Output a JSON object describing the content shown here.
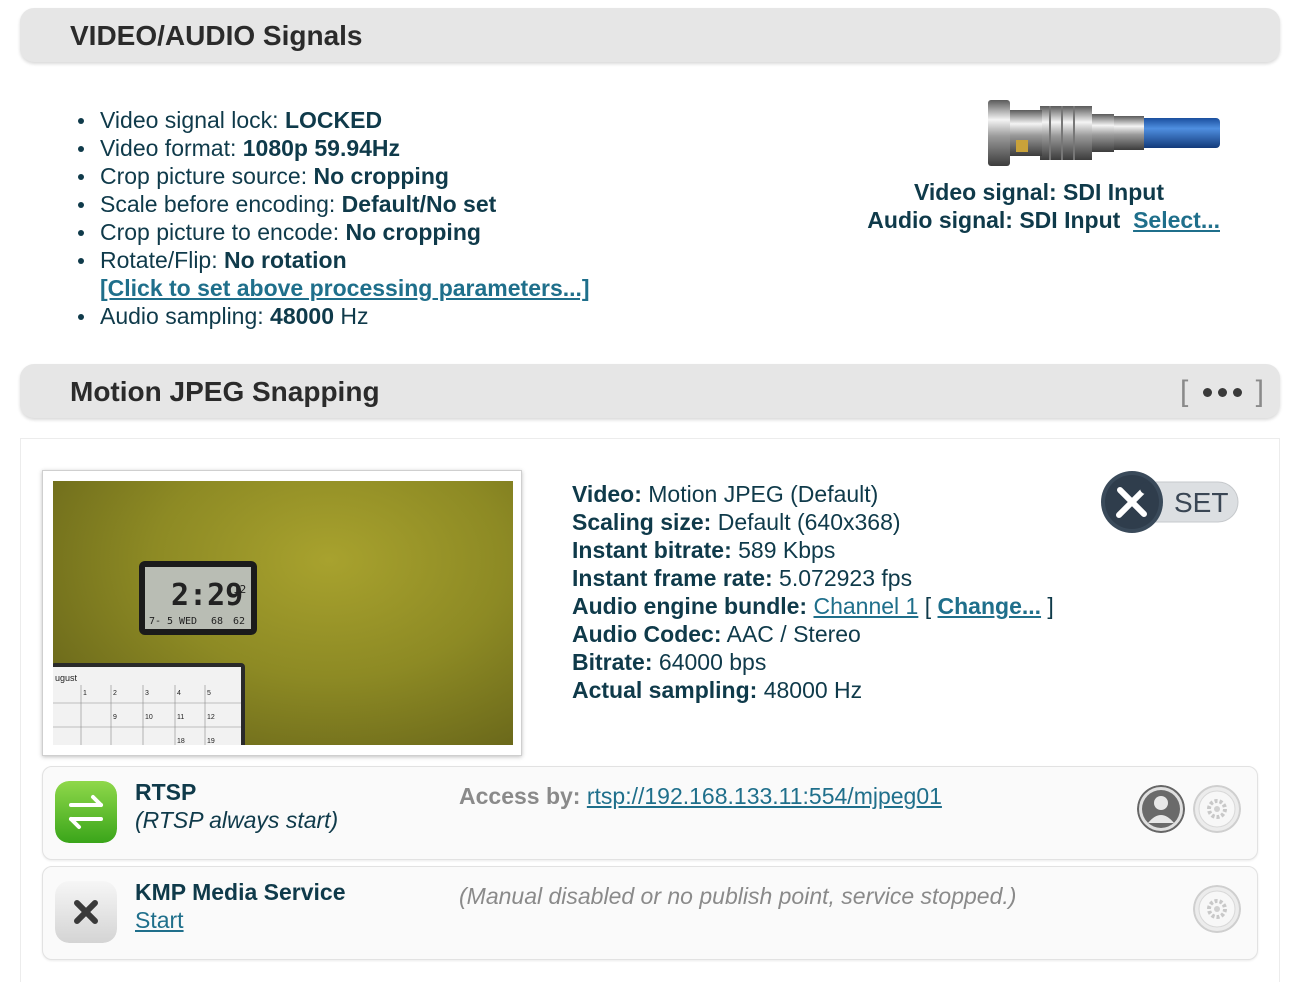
{
  "sections": {
    "signals_title": "VIDEO/AUDIO Signals",
    "mjpeg_title": "Motion JPEG Snapping"
  },
  "signals": {
    "items": [
      {
        "label": "Video signal lock: ",
        "value": "LOCKED",
        "suffix": ""
      },
      {
        "label": "Video format: ",
        "value": "1080p 59.94Hz",
        "suffix": ""
      },
      {
        "label": "Crop picture source: ",
        "value": "No cropping",
        "suffix": ""
      },
      {
        "label": "Scale before encoding: ",
        "value": "Default/No set",
        "suffix": ""
      },
      {
        "label": "Crop picture to encode: ",
        "value": "No cropping",
        "suffix": ""
      },
      {
        "label": "Rotate/Flip: ",
        "value": "No rotation",
        "suffix": ""
      }
    ],
    "processing_link": "[Click to set above processing parameters...]",
    "audio_sampling": {
      "label": "Audio sampling: ",
      "value": "48000",
      "suffix": " Hz"
    },
    "video_signal": "Video signal: SDI Input",
    "audio_signal": "Audio signal: SDI Input",
    "select_link": "Select..."
  },
  "video_info": {
    "video_label": "Video:",
    "video_value": " Motion JPEG (Default)",
    "scaling_label": "Scaling size:",
    "scaling_value": " Default (640x368)",
    "bitrate_label": "Instant bitrate:",
    "bitrate_value": " 589 Kbps",
    "framerate_label": "Instant frame rate:",
    "framerate_value": " 5.072923 fps",
    "audio_bundle_label": "Audio engine bundle:",
    "audio_bundle_link": "Channel 1",
    "change_link": "Change...",
    "codec_label": "Audio Codec:",
    "codec_value": " AAC / Stereo",
    "abitrate_label": "Bitrate:",
    "abitrate_value": " 64000 bps",
    "sampling_label": "Actual sampling:",
    "sampling_value": " 48000 Hz",
    "set_button": "SET"
  },
  "services": {
    "rtsp": {
      "name": "RTSP",
      "sub": "(RTSP always start)",
      "access_label": "Access by:",
      "access_url": "rtsp://192.168.133.11:554/mjpeg01"
    },
    "kmp": {
      "name": "KMP Media Service",
      "start_link": "Start",
      "status": "(Manual disabled or no publish point, service stopped.)"
    }
  },
  "clock": {
    "time": "2:29",
    "seconds": "12",
    "date": "7- 5",
    "day": "WED",
    "temp1": "68",
    "temp2": "62",
    "calendar": "ugust"
  }
}
